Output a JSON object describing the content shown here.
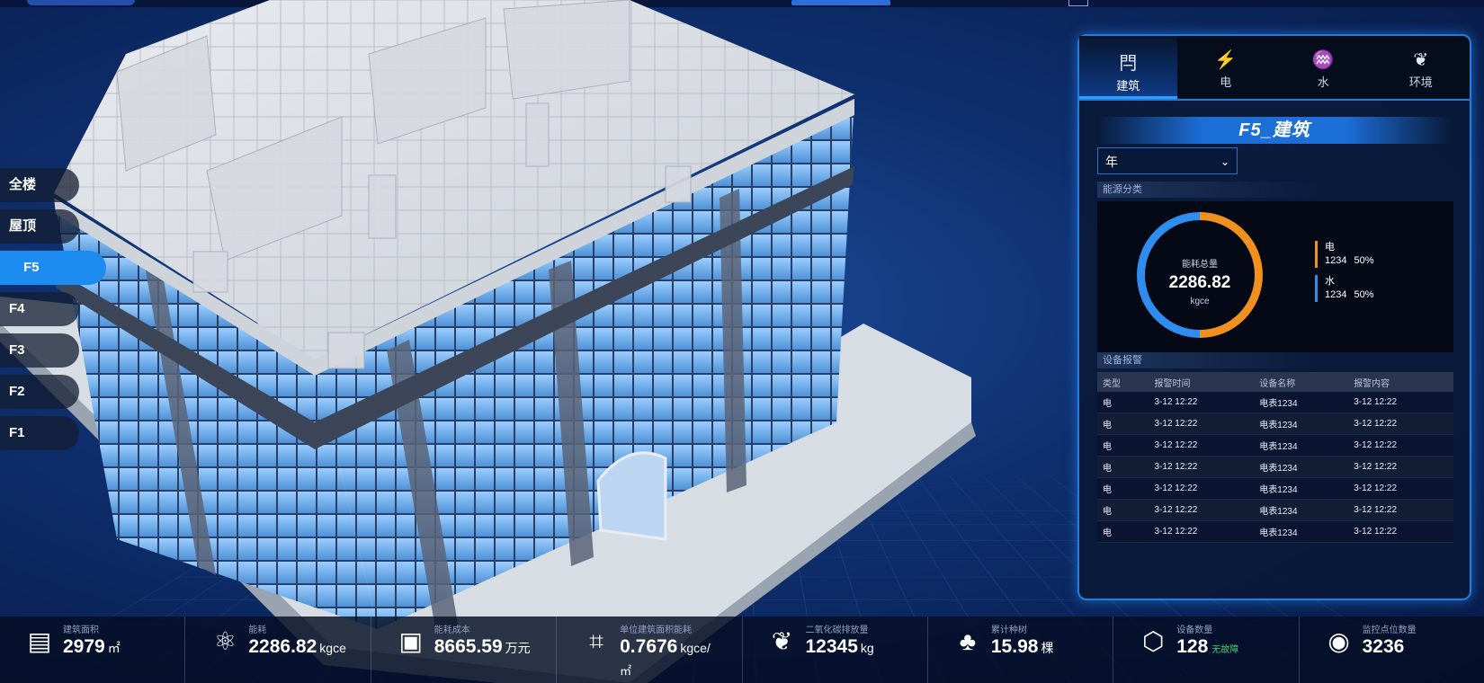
{
  "floors": [
    {
      "label": "全楼"
    },
    {
      "label": "屋顶"
    },
    {
      "label": "F5",
      "active": true
    },
    {
      "label": "F4"
    },
    {
      "label": "F3"
    },
    {
      "label": "F2"
    },
    {
      "label": "F1"
    }
  ],
  "panel": {
    "tabs": [
      {
        "icon": "building-icon",
        "glyph": "閂",
        "label": "建筑",
        "active": true
      },
      {
        "icon": "lightning-icon",
        "glyph": "⚡",
        "label": "电"
      },
      {
        "icon": "water-icon",
        "glyph": "♒",
        "label": "水"
      },
      {
        "icon": "leaf-icon",
        "glyph": "❦",
        "label": "环境"
      }
    ],
    "title": "F5_建筑",
    "period_select": "年",
    "energy_section": "能源分类",
    "ring": {
      "label": "能耗总量",
      "value": "2286.82",
      "unit": "kgce",
      "split": [
        0.5,
        0.5
      ]
    },
    "legend": [
      {
        "name": "电",
        "value": "1234",
        "pct": "50%",
        "color": "#f0901e"
      },
      {
        "name": "水",
        "value": "1234",
        "pct": "50%",
        "color": "#2f8df0"
      }
    ],
    "alarm_section": "设备报警",
    "alarm_headers": [
      "类型",
      "报警时间",
      "设备名称",
      "报警内容"
    ],
    "alarms": [
      [
        "电",
        "3-12 12:22",
        "电表1234",
        "3-12 12:22"
      ],
      [
        "电",
        "3-12 12:22",
        "电表1234",
        "3-12 12:22"
      ],
      [
        "电",
        "3-12 12:22",
        "电表1234",
        "3-12 12:22"
      ],
      [
        "电",
        "3-12 12:22",
        "电表1234",
        "3-12 12:22"
      ],
      [
        "电",
        "3-12 12:22",
        "电表1234",
        "3-12 12:22"
      ],
      [
        "电",
        "3-12 12:22",
        "电表1234",
        "3-12 12:22"
      ],
      [
        "电",
        "3-12 12:22",
        "电表1234",
        "3-12 12:22"
      ]
    ]
  },
  "stats": [
    {
      "icon": "building-area-icon",
      "glyph": "▤",
      "label": "建筑面积",
      "value": "2979",
      "unit": "㎡"
    },
    {
      "icon": "atom-icon",
      "glyph": "⚛",
      "label": "能耗",
      "value": "2286.82",
      "unit": "kgce"
    },
    {
      "icon": "wallet-icon",
      "glyph": "▣",
      "label": "能耗成本",
      "value": "8665.59",
      "unit": "万元"
    },
    {
      "icon": "crop-icon",
      "glyph": "⌗",
      "label": "单位建筑面积能耗",
      "value": "0.7676",
      "unit": "kgce/",
      "extra": "㎡"
    },
    {
      "icon": "leaf-outline-icon",
      "glyph": "❦",
      "label": "二氧化碳排放量",
      "value": "12345",
      "unit": "kg"
    },
    {
      "icon": "tree-icon",
      "glyph": "♣",
      "label": "累计种树",
      "value": "15.98",
      "unit": "棵"
    },
    {
      "icon": "cube-icon",
      "glyph": "⬡",
      "label": "设备数量",
      "value": "128",
      "unit": "",
      "ok": "无故障"
    },
    {
      "icon": "target-icon",
      "glyph": "◉",
      "label": "监控点位数量",
      "value": "3236",
      "unit": ""
    }
  ]
}
